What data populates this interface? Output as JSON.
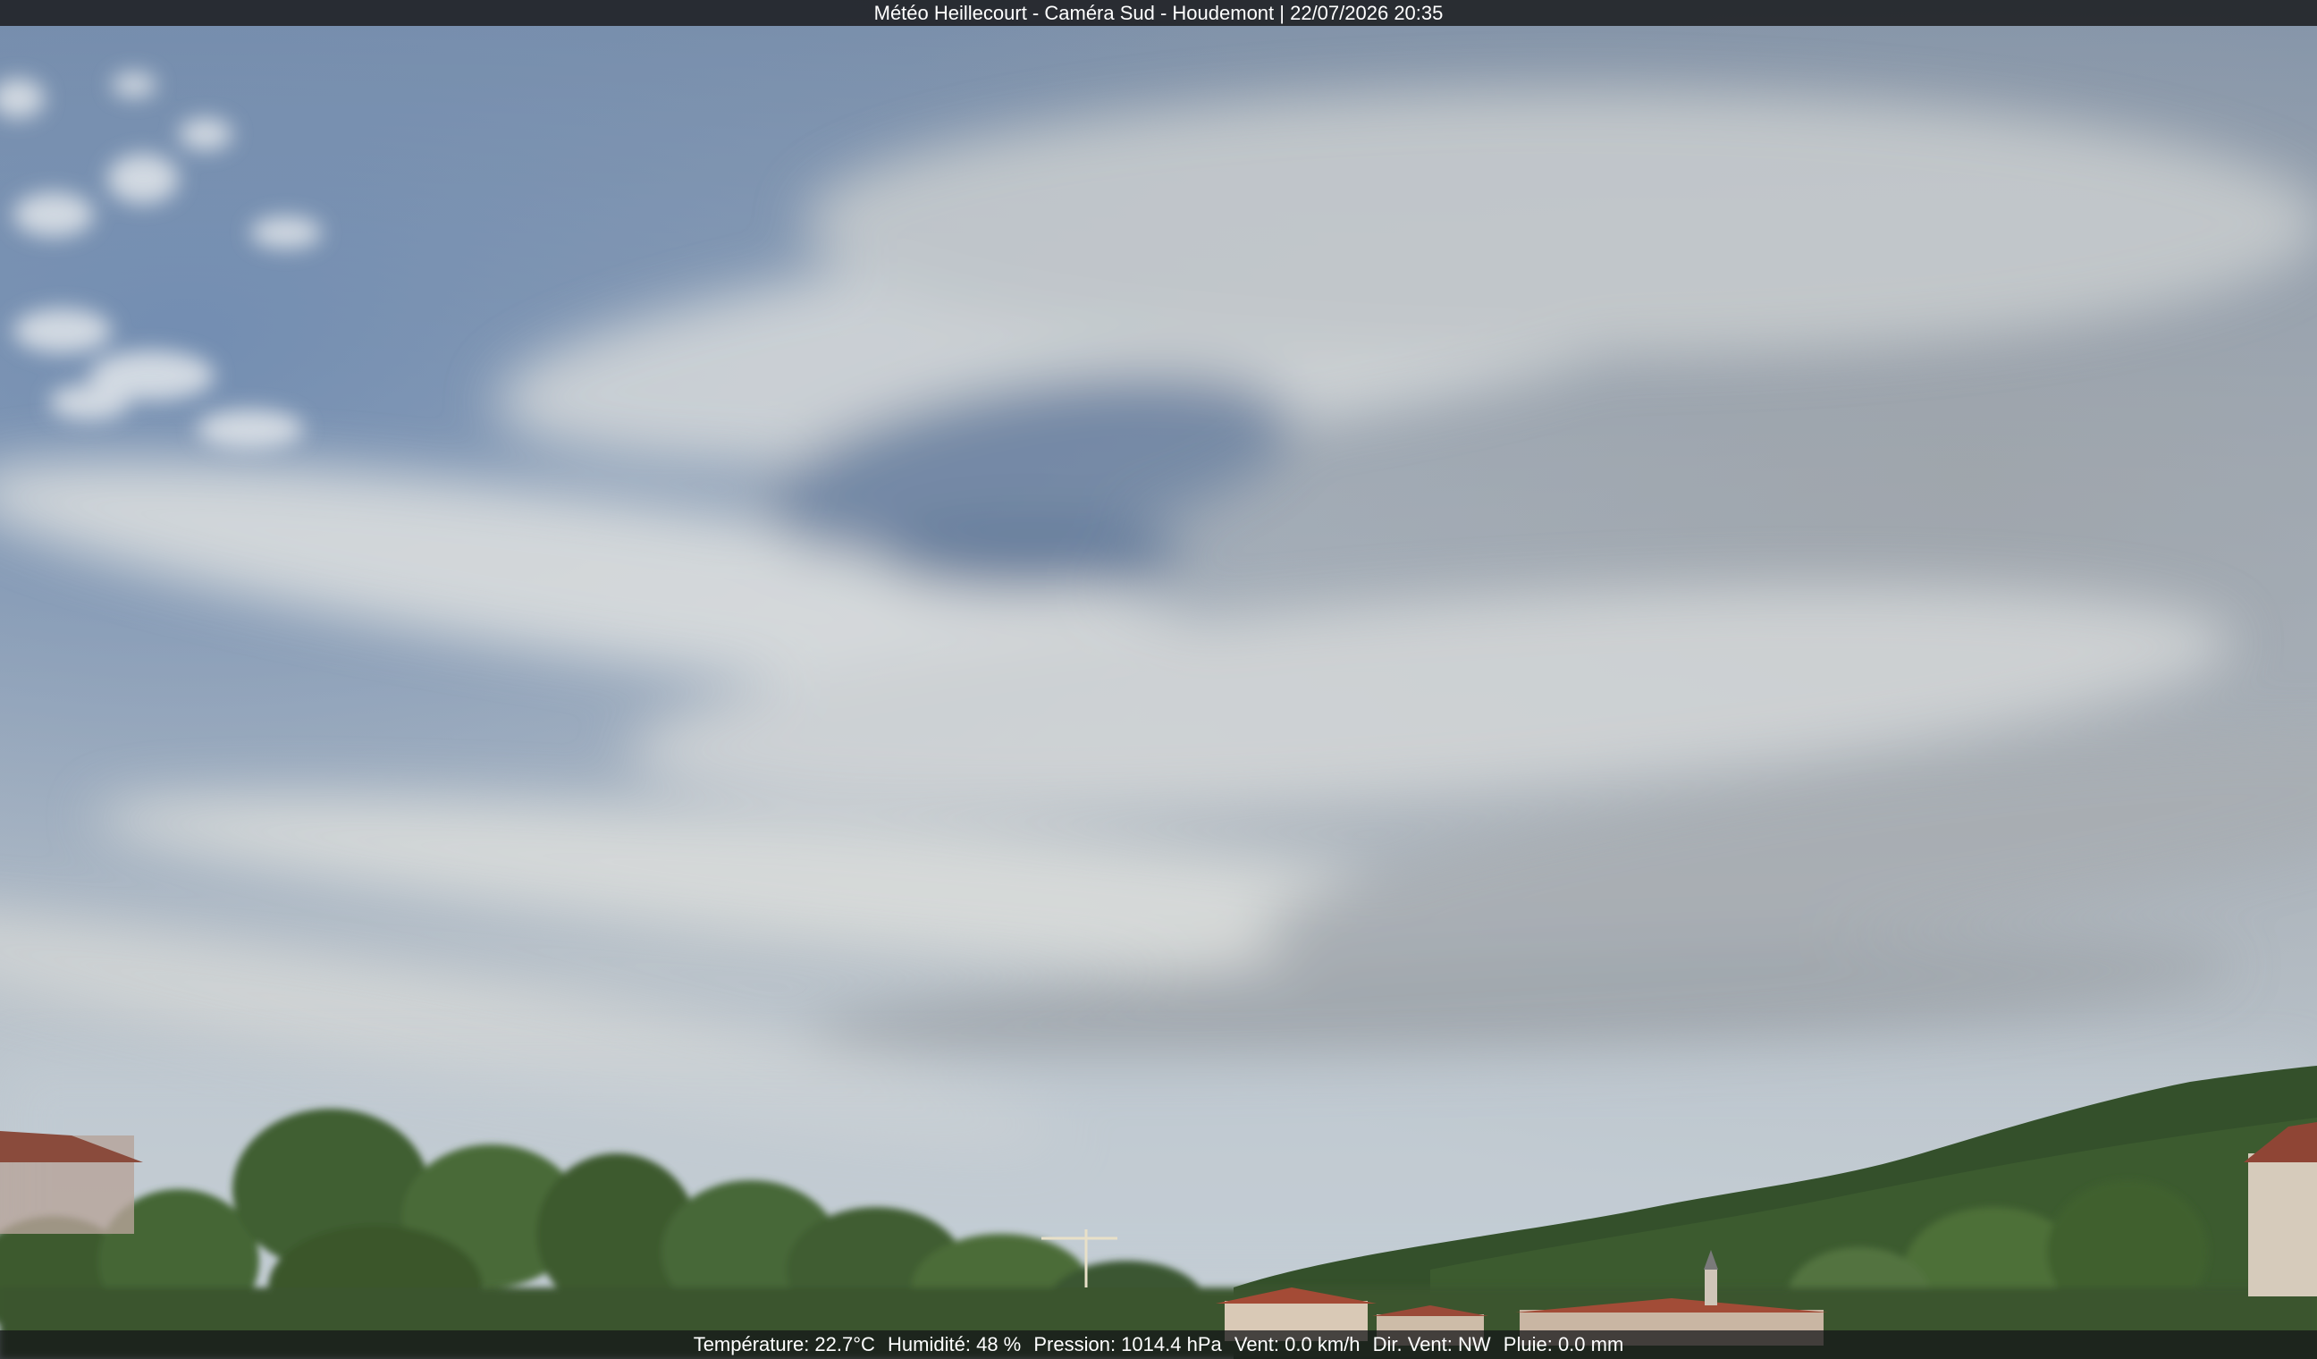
{
  "caption": "Météo Heillecourt - Caméra Sud - Houdemont | 22/07/2026 20:35",
  "weather": [
    "Température: 22.7°C",
    "Humidité: 48 %",
    "Pression: 1014.4 hPa",
    "Vent: 0.0 km/h",
    "Dir. Vent: NW",
    "Pluie: 0.0 mm"
  ],
  "colors": {
    "sky_top": "#7f93ad",
    "sky_mid": "#b9c2cb",
    "sky_horizon": "#c9d2d8",
    "cloud": "#d9dcdc",
    "trees": "#3e5a2c",
    "hill": "#33502a",
    "roof": "#9c4a38"
  }
}
